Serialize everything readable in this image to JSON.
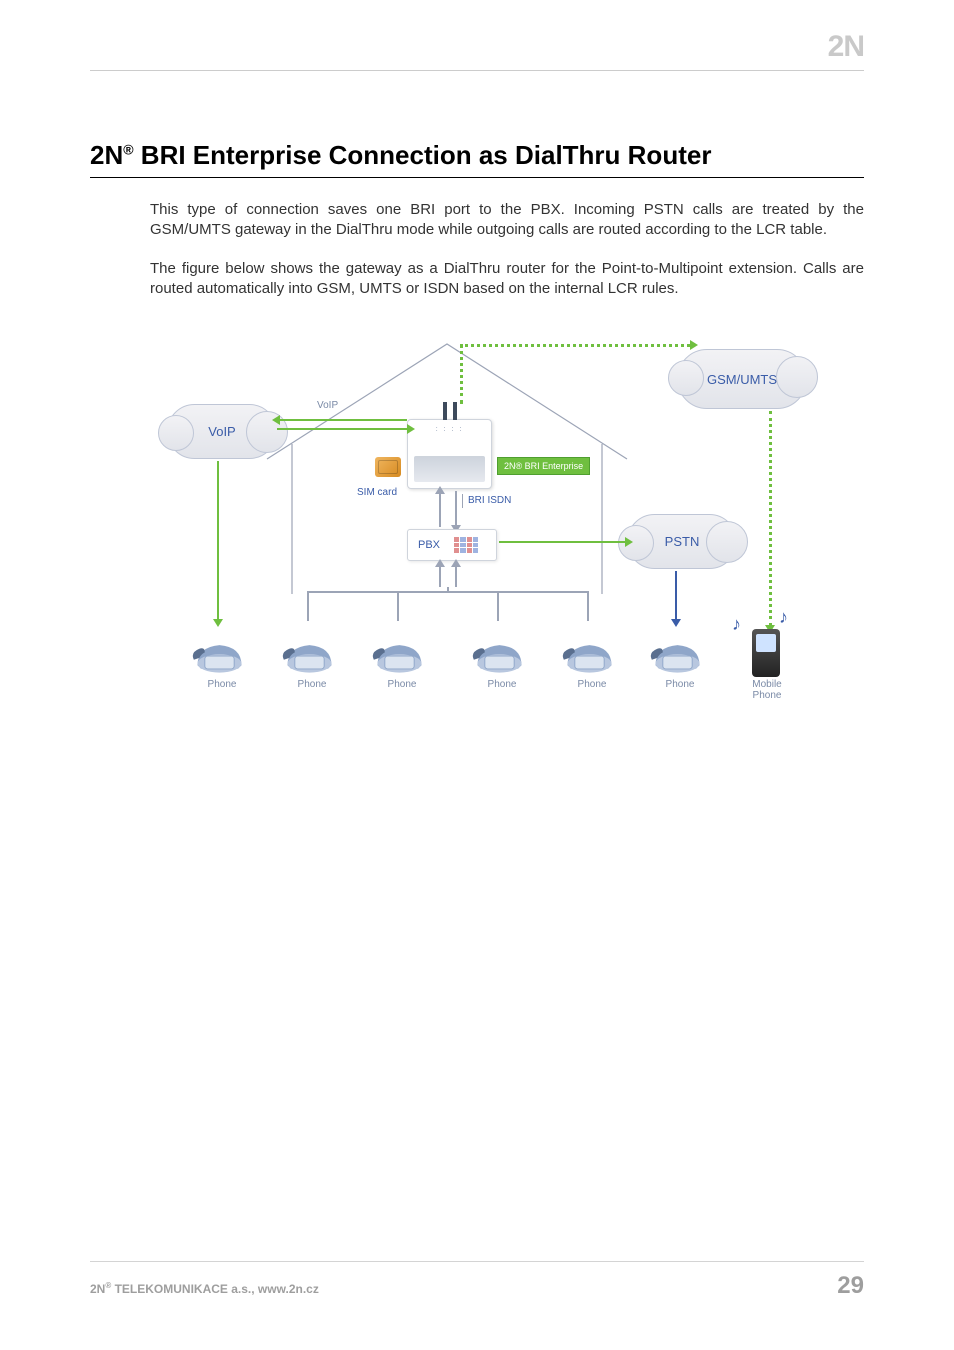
{
  "header": {
    "logo_text": "2N"
  },
  "title": {
    "brand": "2N",
    "sup": "®",
    "rest": " BRI Enterprise Connection as DialThru Router"
  },
  "paragraphs": {
    "p1": "This type of connection saves one BRI port to the PBX. Incoming PSTN calls are treated by the GSM/UMTS gateway in the DialThru mode while outgoing calls are routed according to the LCR table.",
    "p2": "The figure below shows the gateway as a DialThru router for the Point-to-Multipoint extension. Calls are routed automatically into GSM, UMTS or ISDN based on the internal LCR rules."
  },
  "diagram": {
    "clouds": {
      "voip": "VoIP",
      "gsm": "GSM/UMTS",
      "pstn": "PSTN"
    },
    "labels": {
      "voip_link": "VoIP",
      "sim": "SIM card",
      "bri_isdn": "BRI ISDN",
      "gateway_badge": "2N® BRI Enterprise",
      "pbx": "PBX"
    },
    "phones": {
      "phone": "Phone",
      "mobile": "Mobile\nPhone"
    }
  },
  "footer": {
    "company_brand": "2N",
    "company_sup": "®",
    "company_rest": " TELEKOMUNIKACE a.s., www.2n.cz",
    "page_number": "29"
  }
}
